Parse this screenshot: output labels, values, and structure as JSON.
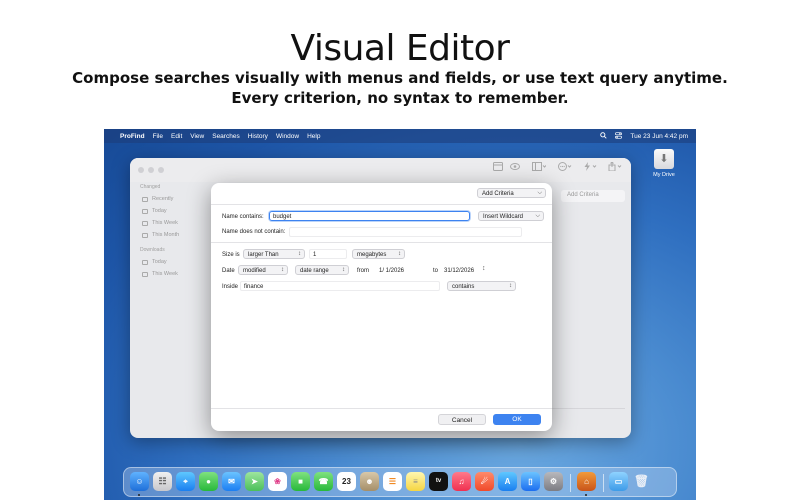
{
  "hero": {
    "title": "Visual Editor",
    "line1": "Compose searches visually with menus and fields, or use text query anytime.",
    "line2": "Every criterion, no syntax to remember."
  },
  "menubar": {
    "app": "ProFind",
    "items": [
      "File",
      "Edit",
      "View",
      "Searches",
      "History",
      "Window",
      "Help"
    ],
    "datetime": "Tue 23 Jun  4:42 pm"
  },
  "finder": {
    "sidebar_sections": [
      {
        "heading": "Changed",
        "items": [
          "Recently",
          "Today",
          "This Week",
          "This Month"
        ]
      },
      {
        "heading": "Downloads",
        "items": [
          "Today",
          "This Week"
        ]
      }
    ],
    "add_criteria_bg": "Add Criteria"
  },
  "dialog": {
    "add_criteria": "Add Criteria",
    "name_contains_label": "Name contains:",
    "name_contains_value": "budget",
    "insert_wildcard": "Insert Wildcard",
    "name_not_contain_label": "Name does not contain:",
    "size_label": "Size is",
    "size_op": "larger Than",
    "size_value": "1",
    "size_unit": "megabytes",
    "date_label": "Date",
    "date_kind": "modified",
    "date_mode": "date range",
    "from_label": "from",
    "from_value": "1/  1/2026",
    "to_label": "to",
    "to_value": "31/12/2026",
    "inside_label": "Inside",
    "inside_value": "finance",
    "inside_op": "contains",
    "cancel": "Cancel",
    "ok": "OK"
  },
  "desktop": {
    "drive_label": "My Drive"
  },
  "dock": {
    "calendar_day": "23",
    "tv_label": "tv"
  },
  "colors": {
    "accent": "#3d83f0",
    "desktop_blue": "#2f6fc0"
  }
}
